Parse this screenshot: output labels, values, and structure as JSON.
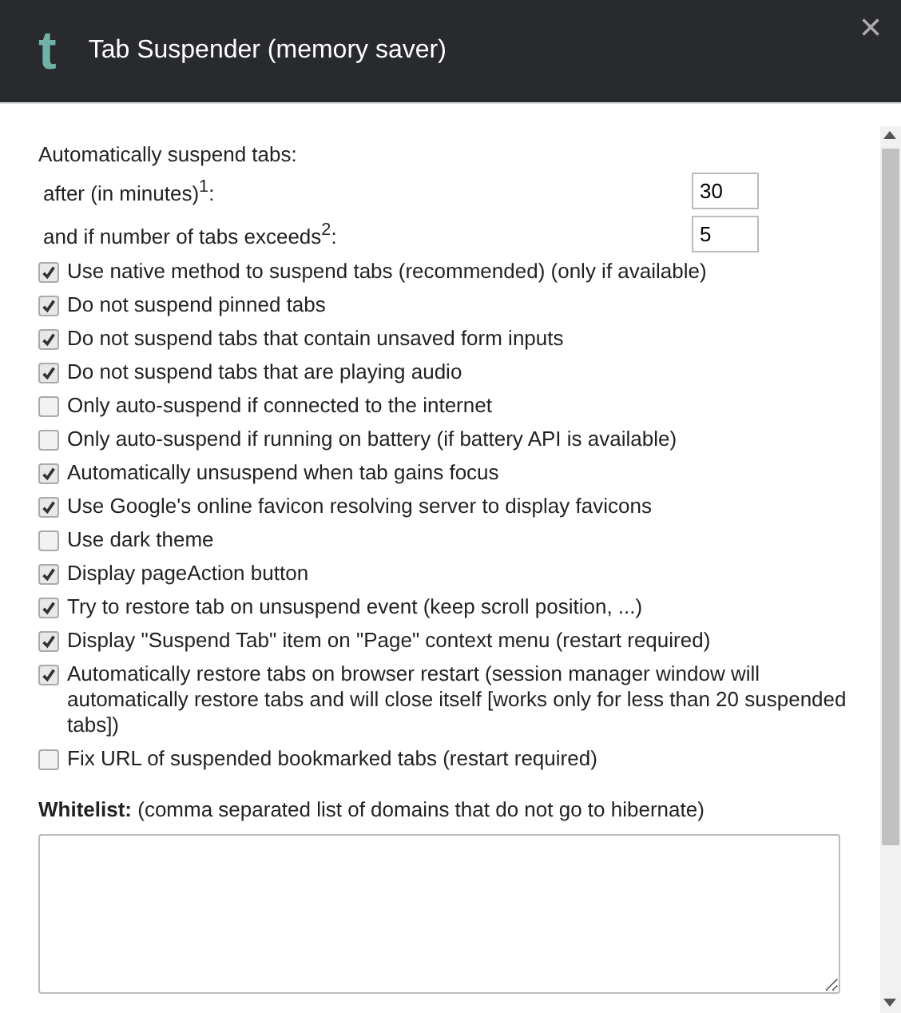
{
  "header": {
    "logo": "t",
    "title": "Tab Suspender (memory saver)",
    "close": "×"
  },
  "intro": "Automatically suspend tabs:",
  "number_fields": [
    {
      "label": "after (in minutes)$^{1}$:",
      "value": "30"
    },
    {
      "label": "and if number of tabs exceeds$^{2}$:",
      "value": "5"
    }
  ],
  "options": [
    {
      "label": "Use native method to suspend tabs (recommended) (only if available)",
      "checked": true
    },
    {
      "label": "Do not suspend pinned tabs",
      "checked": true
    },
    {
      "label": "Do not suspend tabs that contain unsaved form inputs",
      "checked": true
    },
    {
      "label": "Do not suspend tabs that are playing audio",
      "checked": true
    },
    {
      "label": "Only auto-suspend if connected to the internet",
      "checked": false
    },
    {
      "label": "Only auto-suspend if running on battery (if battery API is available)",
      "checked": false
    },
    {
      "label": "Automatically unsuspend when tab gains focus",
      "checked": true
    },
    {
      "label": "Use Google's online favicon resolving server to display favicons",
      "checked": true
    },
    {
      "label": "Use dark theme",
      "checked": false
    },
    {
      "label": "Display pageAction button",
      "checked": true
    },
    {
      "label": "Try to restore tab on unsuspend event (keep scroll position, ...)",
      "checked": true
    },
    {
      "label": "Display \"Suspend Tab\" item on \"Page\" context menu (restart required)",
      "checked": true
    },
    {
      "label": "Automatically restore tabs on browser restart (session manager window will automatically restore tabs and will close itself [works only for less than 20 suspended tabs])",
      "checked": true
    },
    {
      "label": "Fix URL of suspended bookmarked tabs (restart required)",
      "checked": false
    }
  ],
  "whitelist": {
    "label": "**Whitelist:** (comma separated list of domains that do not go to hibernate)"
  }
}
